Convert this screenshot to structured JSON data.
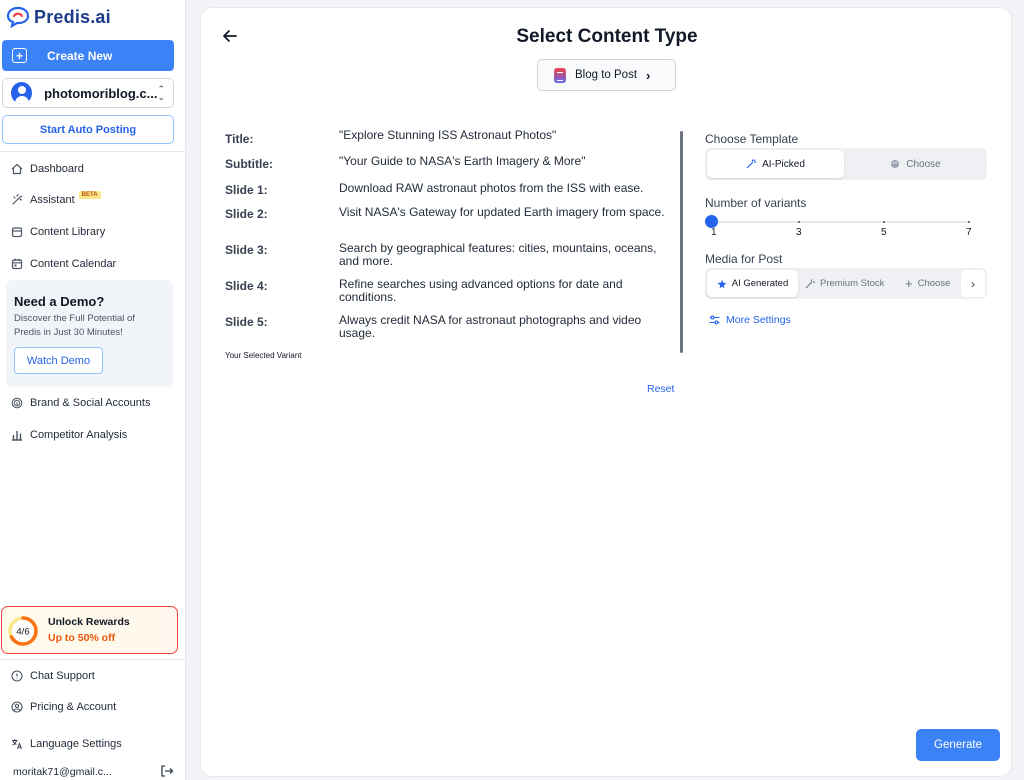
{
  "sidebar": {
    "brand": "Predis.ai",
    "create_label": "Create New",
    "account": "photomoriblog.c...",
    "auto_posting": "Start Auto Posting",
    "nav": [
      {
        "label": "Dashboard",
        "icon": "dashboard-icon"
      },
      {
        "label": "Assistant",
        "icon": "assistant-icon",
        "badge": "BETA"
      },
      {
        "label": "Content Library",
        "icon": "library-icon"
      },
      {
        "label": "Content Calendar",
        "icon": "calendar-icon"
      }
    ],
    "demo": {
      "title": "Need a Demo?",
      "desc": "Discover the Full Potential of Predis in Just 30 Minutes!",
      "button": "Watch Demo"
    },
    "nav2": [
      {
        "label": "Brand & Social Accounts",
        "icon": "fingerprint-icon"
      },
      {
        "label": "Competitor Analysis",
        "icon": "bar-chart-icon"
      }
    ],
    "rewards": {
      "progress": "4/6",
      "progress_fraction": 0.67,
      "title": "Unlock Rewards",
      "subtitle": "Up to 50% off"
    },
    "bottom": [
      {
        "label": "Chat Support",
        "icon": "help-icon"
      },
      {
        "label": "Pricing & Account",
        "icon": "user-circle-icon"
      },
      {
        "label": "Language Settings",
        "icon": "translate-icon"
      }
    ],
    "email": "moritak71@gmail.c..."
  },
  "main": {
    "title": "Select Content Type",
    "type_chip": "Blog to Post",
    "rows": [
      {
        "key": "Title:",
        "value": "\"Explore Stunning ISS Astronaut Photos\""
      },
      {
        "key": "Subtitle:",
        "value": "\"Your Guide to NASA's Earth Imagery & More\""
      },
      {
        "key": "Slide 1:",
        "value": "Download RAW astronaut photos from the ISS with ease."
      },
      {
        "key": "Slide 2:",
        "value": "Visit NASA's Gateway for updated Earth imagery from space."
      },
      {
        "key": "Slide 3:",
        "value": "Search by geographical features: cities, mountains, oceans, and more."
      },
      {
        "key": "Slide 4:",
        "value": "Refine searches using advanced options for date and conditions."
      },
      {
        "key": "Slide 5:",
        "value": "Always credit NASA for astronaut photographs and video usage."
      }
    ],
    "variant_note": "Your Selected Variant",
    "reset": "Reset",
    "template_label": "Choose Template",
    "template_options": [
      "AI-Picked",
      "Choose"
    ],
    "variants_label": "Number of variants",
    "variants_ticks": [
      "1",
      "3",
      "5",
      "7"
    ],
    "variants_value": 1,
    "media_label": "Media for Post",
    "media_options": [
      "AI Generated",
      "Premium Stock",
      "Choose"
    ],
    "more_settings": "More Settings",
    "generate": "Generate"
  },
  "colors": {
    "accent": "#3b82f6",
    "brand": "#1e3a8a",
    "reward_orange": "#ea580c"
  }
}
